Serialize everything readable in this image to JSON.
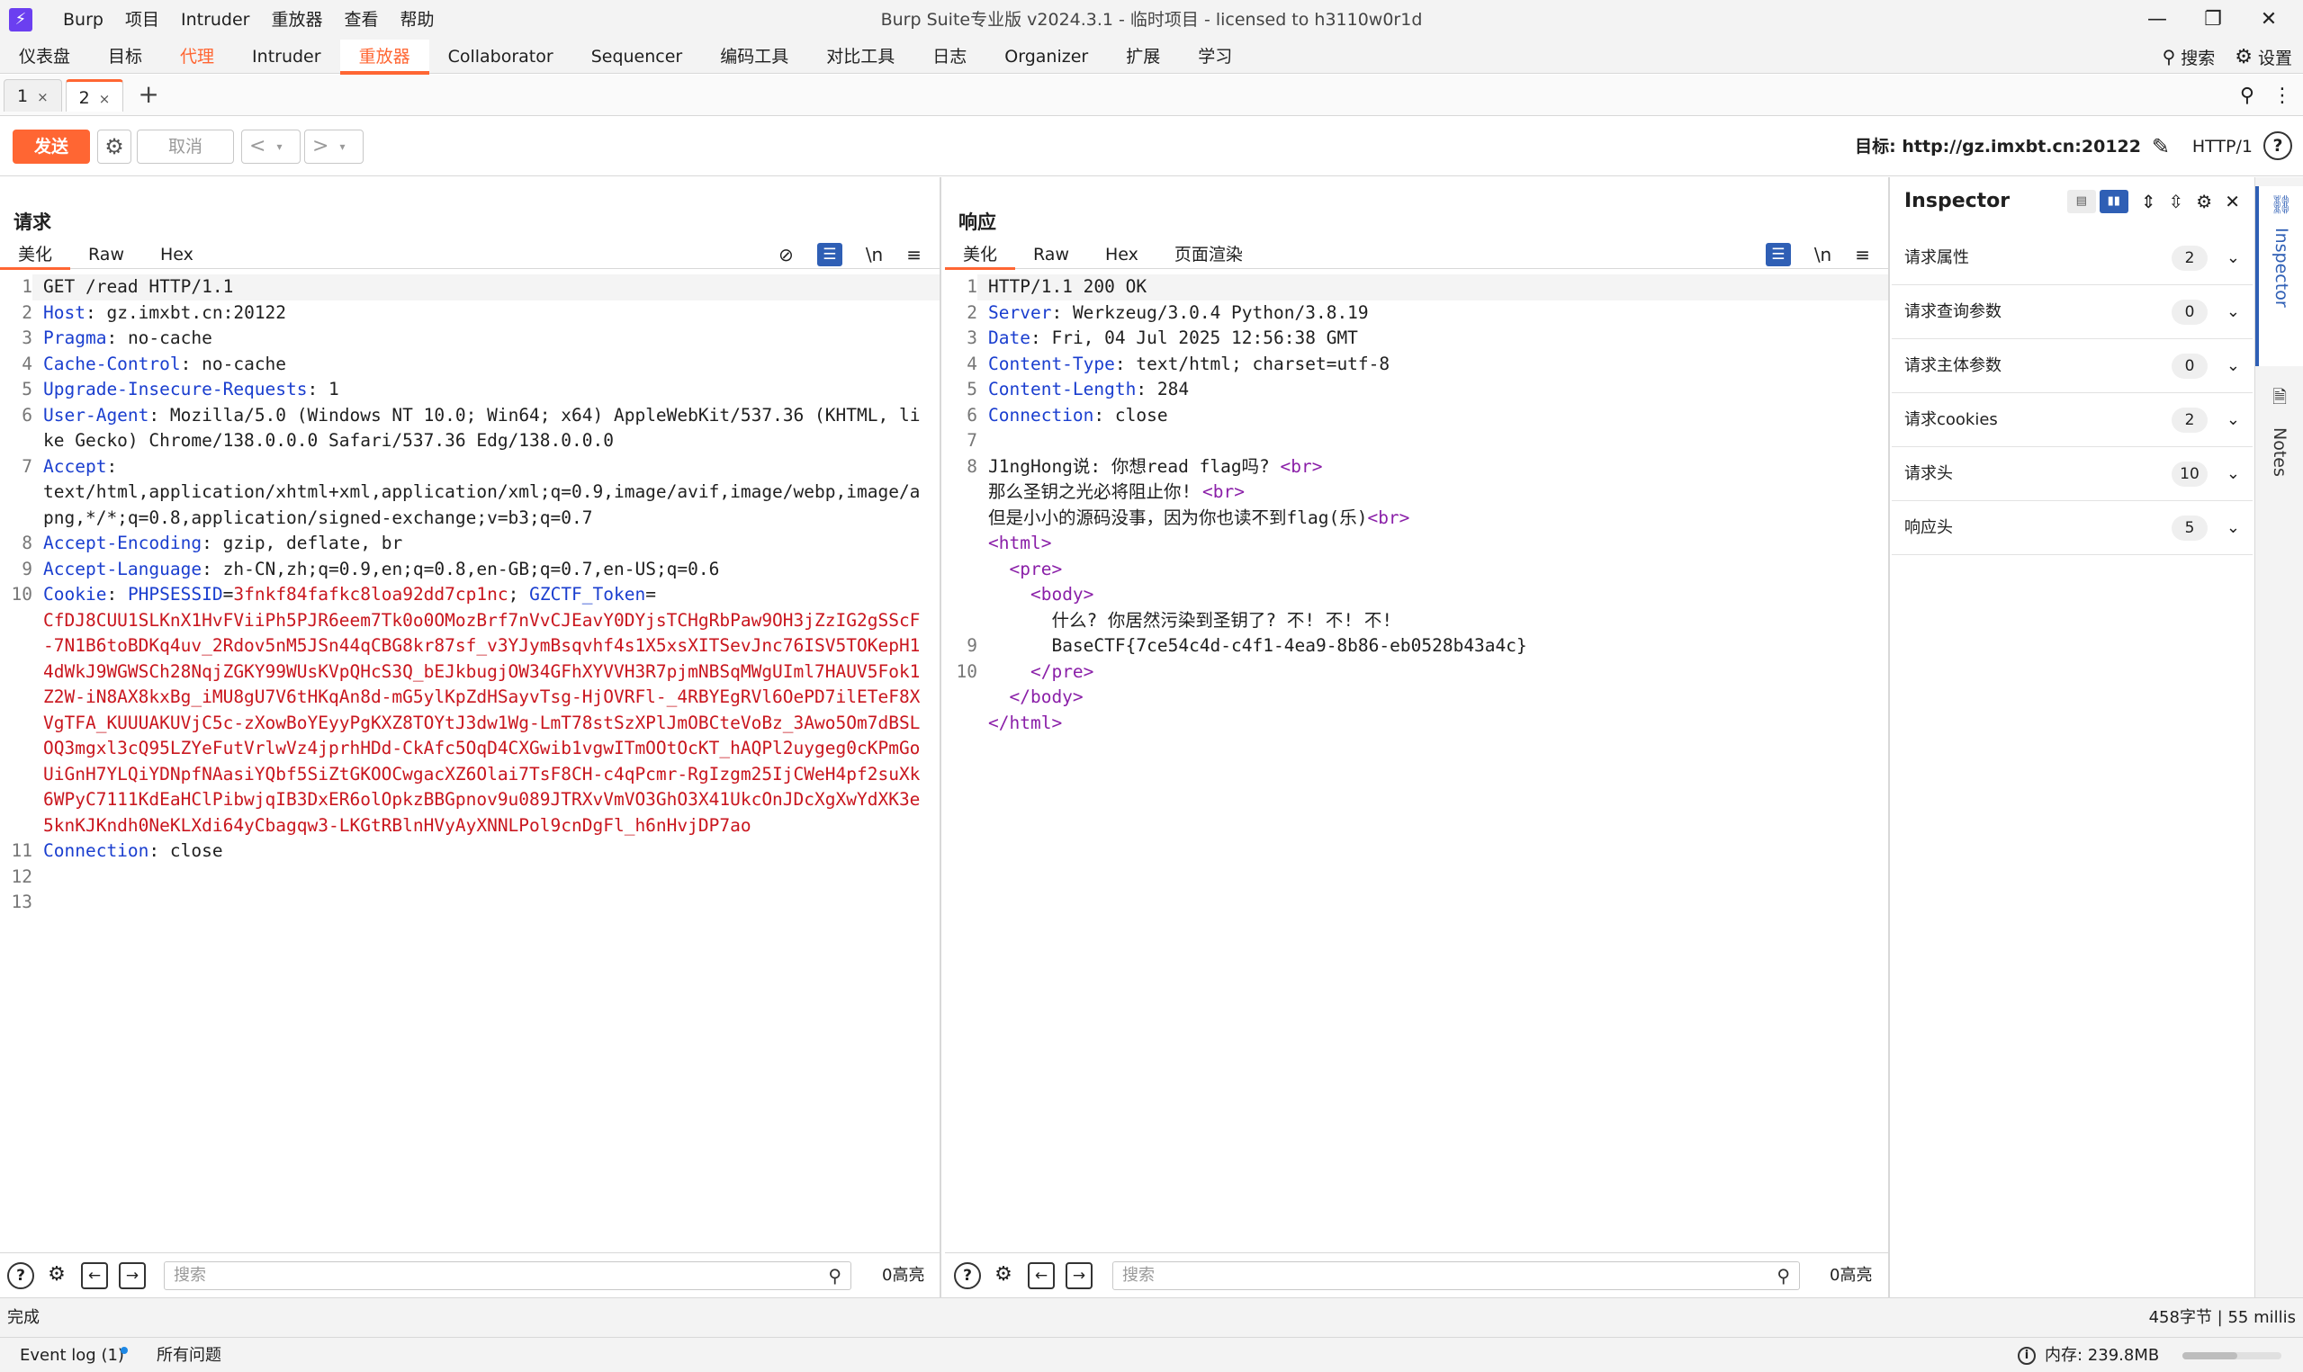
{
  "app": {
    "title": "Burp Suite专业版  v2024.3.1 - 临时项目 - licensed to h3110w0r1d",
    "logo": "⚡",
    "menu": [
      "Burp",
      "项目",
      "Intruder",
      "重放器",
      "查看",
      "帮助"
    ],
    "window_controls": {
      "minimize": "—",
      "maximize": "❐",
      "close": "✕"
    }
  },
  "main_tabs": [
    "仪表盘",
    "目标",
    "代理",
    "Intruder",
    "重放器",
    "Collaborator",
    "Sequencer",
    "编码工具",
    "对比工具",
    "日志",
    "Organizer",
    "扩展",
    "学习"
  ],
  "top_right": {
    "search": "搜索",
    "settings": "设置"
  },
  "repeater_tabs": [
    {
      "label": "1",
      "close": "×"
    },
    {
      "label": "2",
      "close": "×"
    }
  ],
  "add_tab": "+",
  "action_bar": {
    "send": "发送",
    "cancel": "取消",
    "back": "<",
    "forward": ">",
    "dropdown": "▾",
    "target": "目标: http://gz.imxbt.cn:20122",
    "http_version": "HTTP/1",
    "help": "?"
  },
  "request": {
    "title": "请求",
    "tabs": [
      "美化",
      "Raw",
      "Hex"
    ],
    "lines": [
      {
        "n": "1",
        "k": "",
        "v": "GET /read HTTP/1.1"
      },
      {
        "n": "2",
        "k": "Host",
        "v": " gz.imxbt.cn:20122"
      },
      {
        "n": "3",
        "k": "Pragma",
        "v": " no-cache"
      },
      {
        "n": "4",
        "k": "Cache-Control",
        "v": " no-cache"
      },
      {
        "n": "5",
        "k": "Upgrade-Insecure-Requests",
        "v": " 1"
      },
      {
        "n": "6",
        "k": "User-Agent",
        "v": " Mozilla/5.0 (Windows NT 10.0; Win64; x64) AppleWebKit/537.36 (KHTML, like Gecko) Chrome/138.0.0.0 Safari/537.36 Edg/138.0.0.0"
      },
      {
        "n": "7",
        "k": "Accept",
        "v": "\ntext/html,application/xhtml+xml,application/xml;q=0.9,image/avif,image/webp,image/apng,*/*;q=0.8,application/signed-exchange;v=b3;q=0.7"
      },
      {
        "n": "8",
        "k": "Accept-Encoding",
        "v": " gzip, deflate, br"
      },
      {
        "n": "9",
        "k": "Accept-Language",
        "v": " zh-CN,zh;q=0.9,en;q=0.8,en-GB;q=0.7,en-US;q=0.6"
      },
      {
        "n": "10",
        "k": "Cookie",
        "v": "",
        "cookie": true
      },
      {
        "n": "11",
        "k": "Connection",
        "v": " close"
      },
      {
        "n": "12",
        "k": "",
        "v": ""
      },
      {
        "n": "13",
        "k": "",
        "v": ""
      }
    ],
    "cookie": {
      "k1": "PHPSESSID",
      "v1": "3fnkf84fafkc8loa92dd7cp1nc",
      "k2": "GZCTF_Token",
      "v2": "CfDJ8CUU1SLKnX1HvFViiPh5PJR6eem7Tk0o0OMozBrf7nVvCJEavY0DYjsTCHgRbPaw9OH3jZzIG2gSScF-7N1B6toBDKq4uv_2Rdov5nM5JSn44qCBG8kr87sf_v3YJymBsqvhf4s1X5xsXITSevJnc76ISV5TOKepH14dWkJ9WGWSCh28NqjZGKY99WUsKVpQHcS3Q_bEJkbugjOW34GFhXYVVH3R7pjmNBSqMWgUIml7HAUV5Fok1Z2W-iN8AX8kxBg_iMU8gU7V6tHKqAn8d-mG5ylKpZdHSayvTsg-HjOVRFl-_4RBYEgRVl6OePD7ilETeF8XVgTFA_KUUUAKUVjC5c-zXowBoYEyyPgKXZ8TOYtJ3dw1Wg-LmT78stSzXPlJmOBCteVoBz_3Awo5Om7dBSLOQ3mgxl3cQ95LZYeFutVrlwVz4jprhHDd-CkAfc5OqD4CXGwib1vgwITmOOtOcKT_hAQPl2uygeg0cKPmGoUiGnH7YLQiYDNpfNAasiYQbf5SiZtGKOOCwgacXZ6Olai7TsF8CH-c4qPcmr-RgIzgm25IjCWeH4pf2suXk6WPyC7111KdEaHClPibwjqIB3DxER6olOpkzBBGpnov9u089JTRXvVmVO3GhO3X41UkcOnJDcXgXwYdXK3e5knKJKndh0NeKLXdi64yCbagqw3-LKGtRBlnHVyAyXNNLPol9cnDgFl_h6nHvjDP7ao"
    },
    "search_placeholder": "搜索",
    "highlight_count": "0高亮"
  },
  "response": {
    "title": "响应",
    "tabs": [
      "美化",
      "Raw",
      "Hex",
      "页面渲染"
    ],
    "lines": [
      {
        "n": "1",
        "type": "plain",
        "t": "HTTP/1.1 200 OK"
      },
      {
        "n": "2",
        "type": "header",
        "k": "Server",
        "v": " Werkzeug/3.0.4 Python/3.8.19"
      },
      {
        "n": "3",
        "type": "header",
        "k": "Date",
        "v": " Fri, 04 Jul 2025 12:56:38 GMT"
      },
      {
        "n": "4",
        "type": "header",
        "k": "Content-Type",
        "v": " text/html; charset=utf-8"
      },
      {
        "n": "5",
        "type": "header",
        "k": "Content-Length",
        "v": " 284"
      },
      {
        "n": "6",
        "type": "header",
        "k": "Connection",
        "v": " close"
      },
      {
        "n": "7",
        "type": "plain",
        "t": ""
      },
      {
        "n": "8",
        "type": "plain",
        "t": "J1ngHong说: 你想read flag吗? ",
        "tag": "<br>"
      },
      {
        "n": "",
        "type": "plain",
        "t": "那么圣钥之光必将阻止你! ",
        "tag": "<br>"
      },
      {
        "n": "",
        "type": "plain",
        "t": "但是小小的源码没事，因为你也读不到flag(乐)",
        "tag": "<br>"
      },
      {
        "n": "",
        "type": "tagonly",
        "indent": "",
        "tag": "<html>"
      },
      {
        "n": "",
        "type": "tagonly",
        "indent": "  ",
        "tag": "<pre>"
      },
      {
        "n": "",
        "type": "tagonly",
        "indent": "    ",
        "tag": "<body>"
      },
      {
        "n": "",
        "type": "plain",
        "indent": "      ",
        "t": "什么? 你居然污染到圣钥了? 不! 不! 不!"
      },
      {
        "n": "9",
        "type": "plain",
        "indent": "      ",
        "t": "BaseCTF{7ce54c4d-c4f1-4ea9-8b86-eb0528b43a4c}"
      },
      {
        "n": "10",
        "type": "tagonly",
        "indent": "    ",
        "tag": "</pre>"
      },
      {
        "n": "",
        "type": "tagonly",
        "indent": "  ",
        "tag": "</body>"
      },
      {
        "n": "",
        "type": "tagonly",
        "indent": "",
        "tag": "</html>"
      }
    ],
    "search_placeholder": "搜索",
    "highlight_count": "0高亮"
  },
  "inspector": {
    "title": "Inspector",
    "rows": [
      {
        "label": "请求属性",
        "count": "2"
      },
      {
        "label": "请求查询参数",
        "count": "0"
      },
      {
        "label": "请求主体参数",
        "count": "0"
      },
      {
        "label": "请求cookies",
        "count": "2"
      },
      {
        "label": "请求头",
        "count": "10"
      },
      {
        "label": "响应头",
        "count": "5"
      }
    ]
  },
  "side_rail": {
    "inspector": "Inspector",
    "notes": "Notes"
  },
  "status": {
    "left": "完成",
    "right": "458字节 | 55 millis"
  },
  "bottom": {
    "event_log": "Event log (1)",
    "all_issues": "所有问题",
    "memory": "内存: 239.8MB",
    "memory_fraction": 0.55
  },
  "colors": {
    "accent": "#ff6633",
    "blue": "#2f5fb5",
    "header_key": "#1a3ecf",
    "cookie_value": "#c9161e",
    "tag": "#8a1fa8"
  }
}
